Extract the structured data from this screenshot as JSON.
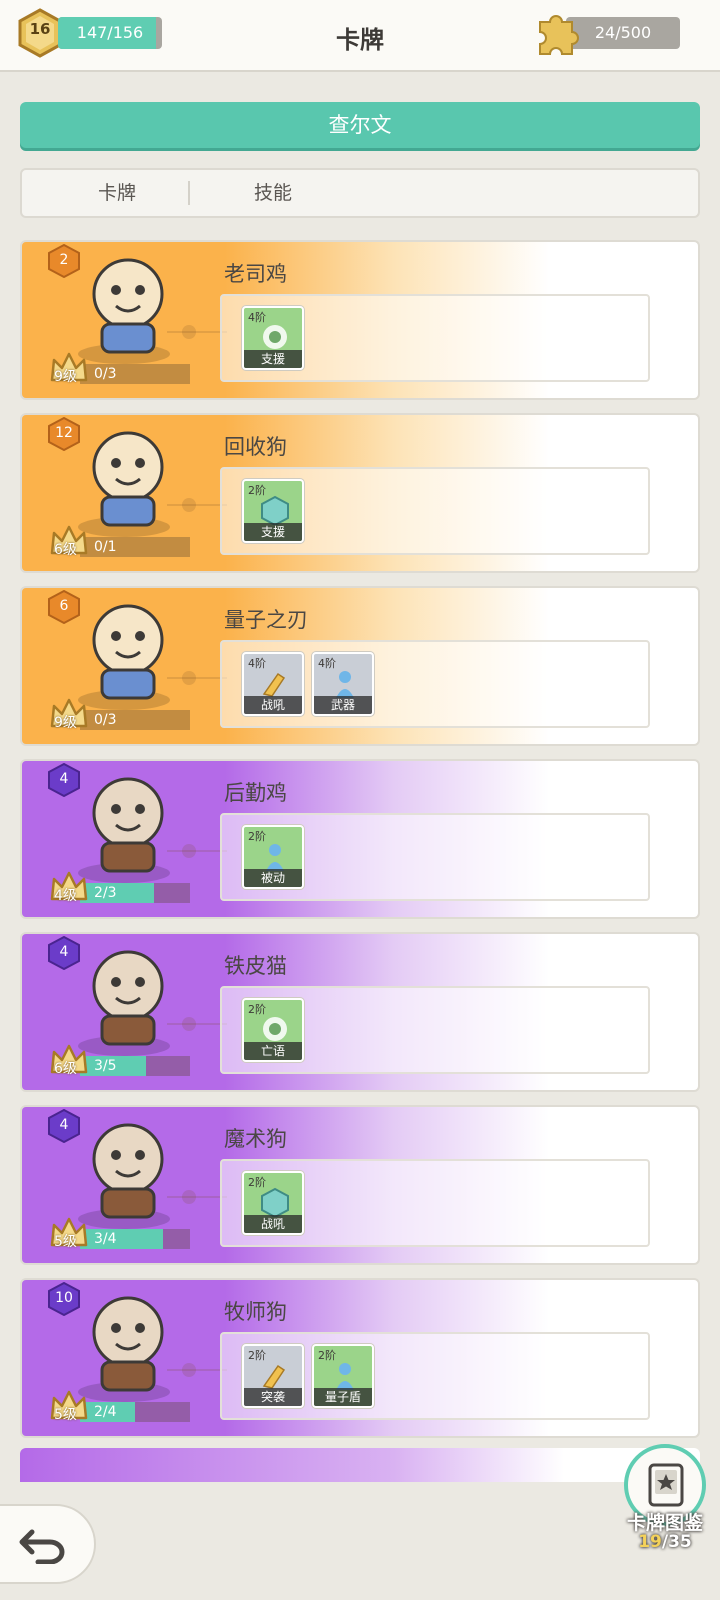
{
  "header": {
    "player_level": "16",
    "xp_text": "147/156",
    "xp_fraction": 0.94,
    "title": "卡牌",
    "puzzle_text": "24/500"
  },
  "hero_name": "查尔文",
  "tabs": [
    {
      "label": "卡牌"
    },
    {
      "label": "技能"
    }
  ],
  "cards": [
    {
      "name": "老司鸡",
      "rarity": "2",
      "theme": "orange",
      "level": "9级",
      "progress": "0/3",
      "progress_fraction": 0,
      "skills": [
        {
          "tier": "4阶",
          "label": "支援"
        }
      ]
    },
    {
      "name": "回收狗",
      "rarity": "12",
      "theme": "orange",
      "level": "6级",
      "progress": "0/1",
      "progress_fraction": 0,
      "skills": [
        {
          "tier": "2阶",
          "label": "支援"
        }
      ]
    },
    {
      "name": "量子之刃",
      "rarity": "6",
      "theme": "orange",
      "level": "9级",
      "progress": "0/3",
      "progress_fraction": 0,
      "skills": [
        {
          "tier": "4阶",
          "label": "战吼"
        },
        {
          "tier": "4阶",
          "label": "武器"
        }
      ]
    },
    {
      "name": "后勤鸡",
      "rarity": "4",
      "theme": "purple",
      "level": "4级",
      "progress": "2/3",
      "progress_fraction": 0.67,
      "skills": [
        {
          "tier": "2阶",
          "label": "被动"
        }
      ]
    },
    {
      "name": "铁皮猫",
      "rarity": "4",
      "theme": "purple",
      "level": "6级",
      "progress": "3/5",
      "progress_fraction": 0.6,
      "skills": [
        {
          "tier": "2阶",
          "label": "亡语"
        }
      ]
    },
    {
      "name": "魔术狗",
      "rarity": "4",
      "theme": "purple",
      "level": "5级",
      "progress": "3/4",
      "progress_fraction": 0.75,
      "skills": [
        {
          "tier": "2阶",
          "label": "战吼"
        }
      ]
    },
    {
      "name": "牧师狗",
      "rarity": "10",
      "theme": "purple",
      "level": "5级",
      "progress": "2/4",
      "progress_fraction": 0.5,
      "skills": [
        {
          "tier": "2阶",
          "label": "突袭"
        },
        {
          "tier": "2阶",
          "label": "量子盾"
        }
      ]
    }
  ],
  "codex": {
    "label": "卡牌图鉴",
    "current": "19",
    "total": "/35"
  },
  "colors": {
    "accent_teal": "#59c7ae",
    "orange_rarity": "#fbb24b",
    "purple_rarity": "#b46ae8"
  }
}
